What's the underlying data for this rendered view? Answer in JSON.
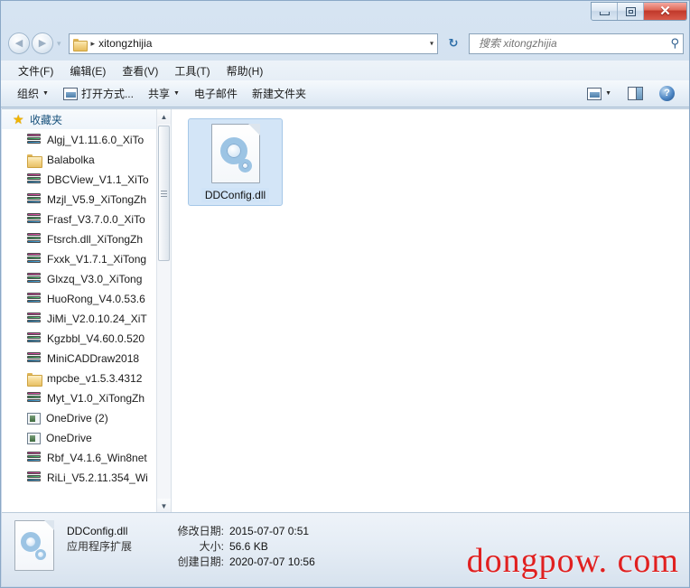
{
  "window": {
    "minimize_label": "–",
    "maximize_label": "□",
    "close_label": "✕"
  },
  "address": {
    "back_glyph": "◀",
    "forward_glyph": "▶",
    "nav_separator": "▾",
    "crumb_separator": "▸",
    "path": "xitongzhijia",
    "dropdown_glyph": "▾",
    "refresh_glyph": "↻"
  },
  "search": {
    "placeholder": "搜索 xitongzhijia",
    "value": "",
    "icon_glyph": "⚲"
  },
  "menu": {
    "items": [
      {
        "label": "文件(F)"
      },
      {
        "label": "编辑(E)"
      },
      {
        "label": "查看(V)"
      },
      {
        "label": "工具(T)"
      },
      {
        "label": "帮助(H)"
      }
    ]
  },
  "toolbar": {
    "organize_label": "组织",
    "open_with_label": "打开方式...",
    "share_label": "共享",
    "email_label": "电子邮件",
    "new_folder_label": "新建文件夹",
    "caret_glyph": "▼",
    "help_label": "?"
  },
  "sidebar": {
    "header": "收藏夹",
    "star_glyph": "★",
    "scroll_up_glyph": "▲",
    "scroll_down_glyph": "▼",
    "items": [
      {
        "label": "Algj_V1.11.6.0_XiTo",
        "icon": "zip-icon"
      },
      {
        "label": "Balabolka",
        "icon": "folder-icon"
      },
      {
        "label": "DBCView_V1.1_XiTo",
        "icon": "zip-icon"
      },
      {
        "label": "Mzjl_V5.9_XiTongZh",
        "icon": "zip-icon"
      },
      {
        "label": "Frasf_V3.7.0.0_XiTo",
        "icon": "zip-icon"
      },
      {
        "label": "Ftsrch.dll_XiTongZh",
        "icon": "zip-icon"
      },
      {
        "label": "Fxxk_V1.7.1_XiTong",
        "icon": "zip-icon"
      },
      {
        "label": "Glxzq_V3.0_XiTong",
        "icon": "zip-icon"
      },
      {
        "label": "HuoRong_V4.0.53.6",
        "icon": "zip-icon"
      },
      {
        "label": "JiMi_V2.0.10.24_XiT",
        "icon": "zip-icon"
      },
      {
        "label": "Kgzbbl_V4.60.0.520",
        "icon": "zip-icon"
      },
      {
        "label": "MiniCADDraw2018",
        "icon": "zip-icon"
      },
      {
        "label": "mpcbe_v1.5.3.4312",
        "icon": "folder-icon"
      },
      {
        "label": "Myt_V1.0_XiTongZh",
        "icon": "zip-icon"
      },
      {
        "label": "OneDrive (2)",
        "icon": "onedrive-icon"
      },
      {
        "label": "OneDrive",
        "icon": "onedrive-icon"
      },
      {
        "label": "Rbf_V4.1.6_Win8net",
        "icon": "zip-icon"
      },
      {
        "label": "RiLi_V5.2.11.354_Wi",
        "icon": "zip-icon"
      }
    ]
  },
  "files": {
    "selected": {
      "name": "DDConfig.dll",
      "icon": "dll-gear-icon"
    }
  },
  "status": {
    "name": "DDConfig.dll",
    "type": "应用程序扩展",
    "modified_key": "修改日期:",
    "modified_value": "2015-07-07 0:51",
    "size_key": "大小:",
    "size_value": "56.6 KB",
    "created_key": "创建日期:",
    "created_value": "2020-07-07 10:56"
  },
  "watermark": {
    "text": "dongpow. com",
    "color": "#e02020"
  }
}
